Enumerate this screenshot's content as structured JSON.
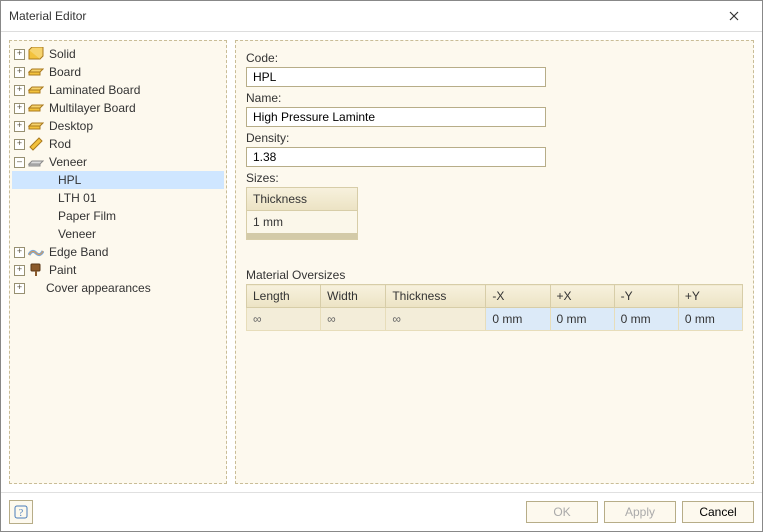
{
  "window": {
    "title": "Material Editor"
  },
  "tree": {
    "items": [
      {
        "label": "Solid",
        "icon": "solid",
        "expanded": false
      },
      {
        "label": "Board",
        "icon": "board",
        "expanded": false
      },
      {
        "label": "Laminated Board",
        "icon": "board",
        "expanded": false
      },
      {
        "label": "Multilayer Board",
        "icon": "board",
        "expanded": false
      },
      {
        "label": "Desktop",
        "icon": "board",
        "expanded": false
      },
      {
        "label": "Rod",
        "icon": "rod",
        "expanded": false
      },
      {
        "label": "Veneer",
        "icon": "veneer",
        "expanded": true
      },
      {
        "label": "Edge Band",
        "icon": "edgeband",
        "expanded": false
      },
      {
        "label": "Paint",
        "icon": "paint",
        "expanded": false
      },
      {
        "label": "Cover appearances",
        "icon": "none",
        "expanded": false
      }
    ],
    "veneer_children": [
      {
        "label": "HPL",
        "selected": true
      },
      {
        "label": "LTH 01",
        "selected": false
      },
      {
        "label": "Paper Film",
        "selected": false
      },
      {
        "label": "Veneer",
        "selected": false
      }
    ]
  },
  "form": {
    "code_label": "Code:",
    "code_value": "HPL",
    "name_label": "Name:",
    "name_value": "High Pressure Laminte",
    "density_label": "Density:",
    "density_value": "1.38",
    "sizes_label": "Sizes:",
    "sizes_table": {
      "header": "Thickness",
      "row": "1 mm"
    },
    "oversizes_label": "Material Oversizes",
    "oversizes": {
      "headers": [
        "Length",
        "Width",
        "Thickness",
        "-X",
        "+X",
        "-Y",
        "+Y"
      ],
      "row": [
        "∞",
        "∞",
        "∞",
        "0 mm",
        "0 mm",
        "0 mm",
        "0 mm"
      ]
    }
  },
  "footer": {
    "ok_label": "OK",
    "apply_label": "Apply",
    "cancel_label": "Cancel"
  }
}
